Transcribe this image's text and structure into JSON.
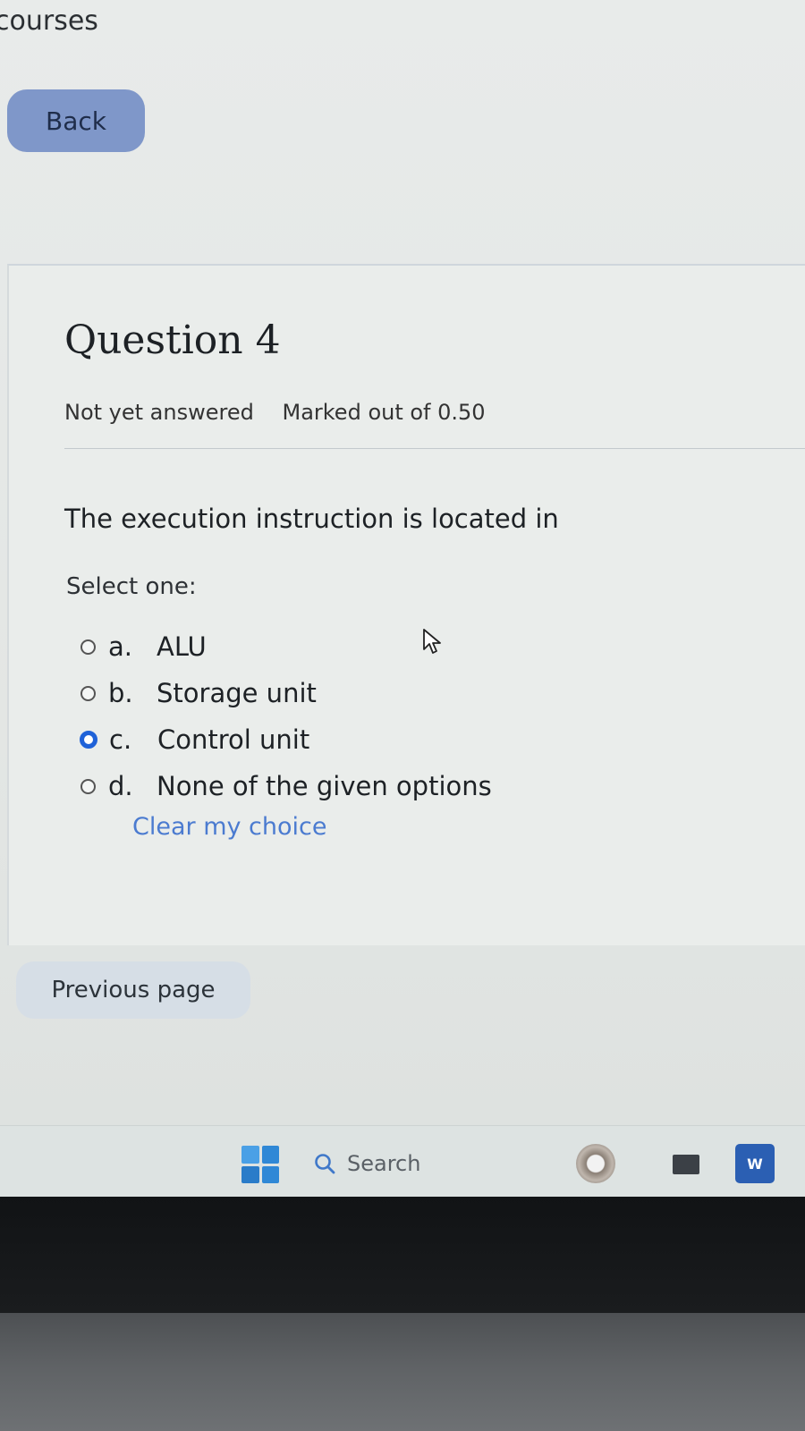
{
  "header": {
    "nav_label": "courses",
    "back_label": "Back"
  },
  "question": {
    "title": "Question 4",
    "status": "Not yet answered",
    "marks": "Marked out of 0.50",
    "text": "The execution instruction is located in",
    "select_label": "Select one:",
    "options": [
      {
        "letter": "a.",
        "label": "ALU",
        "selected": false
      },
      {
        "letter": "b.",
        "label": "Storage unit",
        "selected": false
      },
      {
        "letter": "c.",
        "label": "Control unit",
        "selected": true
      },
      {
        "letter": "d.",
        "label": "None of the given options",
        "selected": false
      }
    ],
    "clear_label": "Clear my choice"
  },
  "navigation": {
    "previous_label": "Previous page"
  },
  "taskbar": {
    "search_label": "Search",
    "word_glyph": "W",
    "icons": [
      "windows-start-icon",
      "search-icon",
      "app-icon",
      "file-explorer-icon",
      "word-icon"
    ]
  },
  "colors": {
    "accent": "#1f62d8",
    "back_button": "#7f97c9",
    "link": "#4b7bd0"
  }
}
